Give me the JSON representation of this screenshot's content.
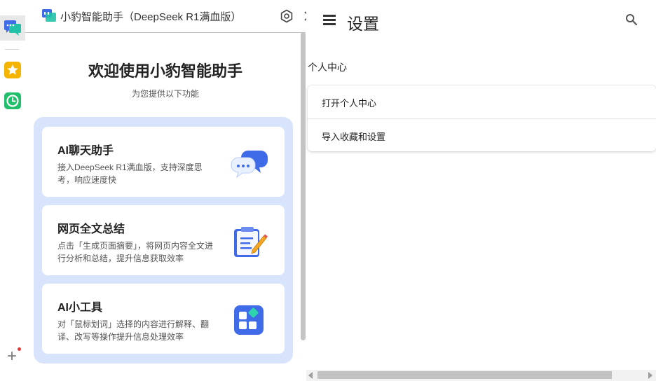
{
  "sidebar": {
    "icons": [
      "chat-bubbles-icon",
      "star-icon",
      "clock-icon"
    ],
    "add_label": "+",
    "has_notification": true
  },
  "panel": {
    "title": "小豹智能助手（DeepSeek R1满血版）",
    "welcome": "欢迎使用小豹智能助手",
    "subtitle": "为您提供以下功能",
    "features": [
      {
        "title": "AI聊天助手",
        "desc": "接入DeepSeek R1满血版，支持深度思考，响应速度快",
        "icon": "chat-bubbles-icon"
      },
      {
        "title": "网页全文总结",
        "desc": "点击「生成页面摘要」，将网页内容全文进行分析和总结，提升信息获取效率",
        "icon": "clipboard-pencil-icon"
      },
      {
        "title": "AI小工具",
        "desc": "对「鼠标划词」选择的内容进行解释、翻译、改写等操作提升信息处理效率",
        "icon": "app-grid-icon"
      }
    ]
  },
  "settings": {
    "title": "设置",
    "section": "个人中心",
    "items": [
      "打开个人中心",
      "导入收藏和设置"
    ]
  },
  "colors": {
    "feature_bg": "#d8e4fb",
    "brand_blue": "#3f6be8",
    "star_yellow": "#f5b400",
    "clock_green": "#1fbf6b"
  }
}
